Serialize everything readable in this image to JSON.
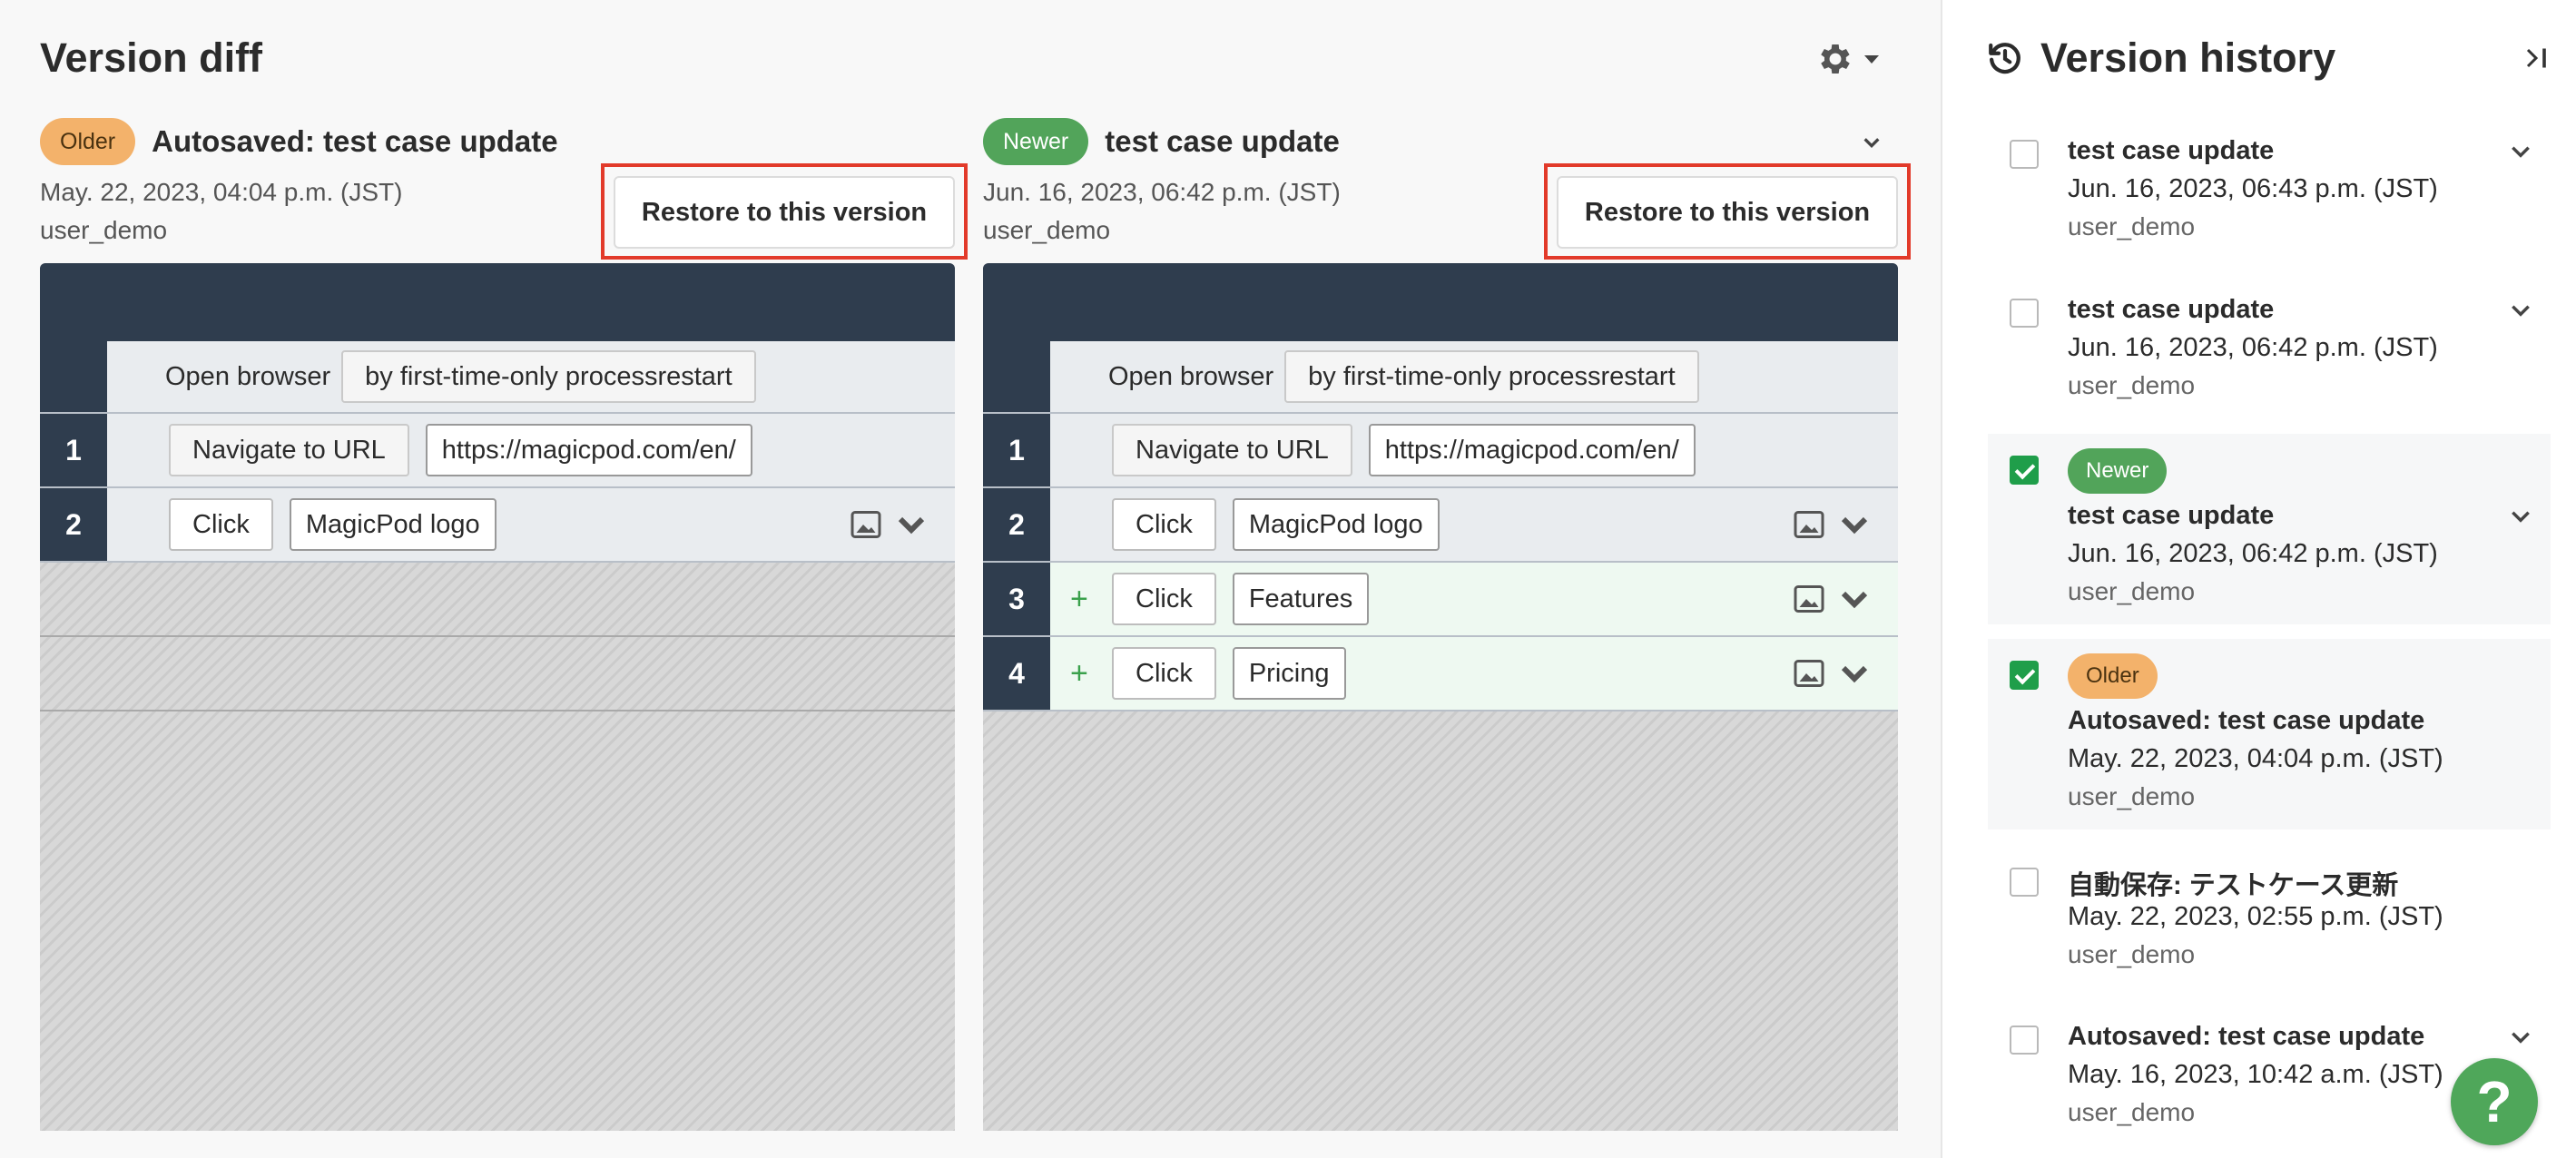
{
  "page": {
    "title": "Version diff"
  },
  "colors": {
    "older_badge": "#f3b26b",
    "newer_badge": "#52a45a",
    "header_dark": "#2f3d4e",
    "highlight_red": "#e23a2a",
    "added_green": "#3aa14c"
  },
  "older": {
    "badge": "Older",
    "title": "Autosaved: test case update",
    "date": "May. 22, 2023, 04:04 p.m. (JST)",
    "user": "user_demo",
    "restore_label": "Restore to this version",
    "rows": [
      {
        "num": "",
        "label": "Open browser",
        "param": "by first-time-only processrestart"
      },
      {
        "num": "1",
        "command": "Navigate to URL",
        "param": "https://magicpod.com/en/"
      },
      {
        "num": "2",
        "command": "Click",
        "param": "MagicPod logo"
      }
    ]
  },
  "newer": {
    "badge": "Newer",
    "title": "test case update",
    "date": "Jun. 16, 2023, 06:42 p.m. (JST)",
    "user": "user_demo",
    "restore_label": "Restore to this version",
    "rows": [
      {
        "num": "",
        "label": "Open browser",
        "param": "by first-time-only processrestart"
      },
      {
        "num": "1",
        "command": "Navigate to URL",
        "param": "https://magicpod.com/en/"
      },
      {
        "num": "2",
        "command": "Click",
        "param": "MagicPod logo"
      },
      {
        "num": "3",
        "marker": "+",
        "command": "Click",
        "param": "Features"
      },
      {
        "num": "4",
        "marker": "+",
        "command": "Click",
        "param": "Pricing"
      }
    ]
  },
  "sidebar": {
    "title": "Version history",
    "items": [
      {
        "title": "test case update",
        "date": "Jun. 16, 2023, 06:43 p.m. (JST)",
        "user": "user_demo"
      },
      {
        "title": "test case update",
        "date": "Jun. 16, 2023, 06:42 p.m. (JST)",
        "user": "user_demo"
      },
      {
        "badge": "Newer",
        "title": "test case update",
        "date": "Jun. 16, 2023, 06:42 p.m. (JST)",
        "user": "user_demo"
      },
      {
        "badge": "Older",
        "title": "Autosaved: test case update",
        "date": "May. 22, 2023, 04:04 p.m. (JST)",
        "user": "user_demo"
      },
      {
        "title": "自動保存: テストケース更新",
        "date": "May. 22, 2023, 02:55 p.m. (JST)",
        "user": "user_demo"
      },
      {
        "title": "Autosaved: test case update",
        "date": "May. 16, 2023, 10:42 a.m. (JST)",
        "user": "user_demo"
      }
    ]
  },
  "help": {
    "label": "?"
  }
}
